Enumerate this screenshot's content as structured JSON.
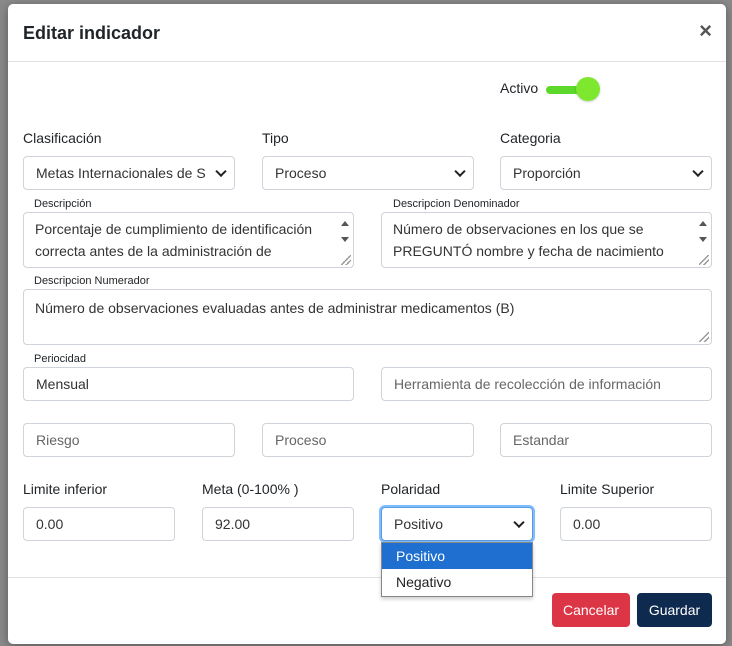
{
  "modal": {
    "title": "Editar indicador",
    "close_glyph": "×"
  },
  "activo": {
    "label": "Activo",
    "state": "on",
    "color": "#7ee82f"
  },
  "clasificacion": {
    "label": "Clasificación",
    "value": "Metas Internacionales de Seguridad del Paciente"
  },
  "tipo": {
    "label": "Tipo",
    "value": "Proceso"
  },
  "categoria": {
    "label": "Categoria",
    "value": "Proporción"
  },
  "descripcion": {
    "label": "Descripción",
    "value": "Porcentaje de cumplimiento de identificación correcta antes de la administración de"
  },
  "descripcion_denominador": {
    "label": "Descripcion Denominador",
    "value": "Número de observaciones en los que se PREGUNTÓ nombre y fecha de nacimiento"
  },
  "descripcion_numerador": {
    "label": "Descripcion Numerador",
    "value": "Número de observaciones evaluadas antes de administrar medicamentos (B)"
  },
  "periodicidad": {
    "label": "Periocidad",
    "value": "Mensual"
  },
  "herramienta": {
    "placeholder": "Herramienta de recolección de información"
  },
  "riesgo": {
    "placeholder": "Riesgo"
  },
  "proceso": {
    "placeholder": "Proceso"
  },
  "estandar": {
    "placeholder": "Estandar"
  },
  "limite_inferior": {
    "label": "Limite inferior",
    "value": "0.00"
  },
  "meta": {
    "label": "Meta (0-100% )",
    "value": "92.00"
  },
  "polaridad": {
    "label": "Polaridad",
    "value": "Positivo",
    "options": [
      "Positivo",
      "Negativo"
    ]
  },
  "limite_superior": {
    "label": "Limite Superior",
    "value": "0.00"
  },
  "buttons": {
    "cancel": "Cancelar",
    "save": "Guardar",
    "cancel_color": "#dc3545",
    "save_color": "#0f2a4f"
  }
}
